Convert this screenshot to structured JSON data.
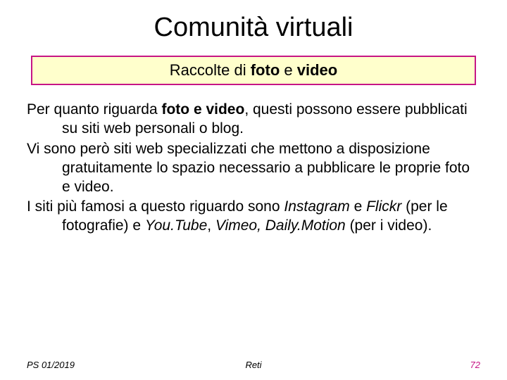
{
  "title": "Comunità virtuali",
  "subtitle_pre": "Raccolte di ",
  "subtitle_bold": "foto",
  "subtitle_mid": " e ",
  "subtitle_bold2": "video",
  "p1_a": "Per quanto riguarda ",
  "p1_b": "foto e video",
  "p1_c": ", questi possono essere pubblicati su siti web personali o blog.",
  "p2": "Vi sono però siti web specializzati che mettono a disposizione gratuitamente lo spazio necessario a pubblicare le proprie foto e video.",
  "p3_a": "I siti più famosi a questo riguardo sono ",
  "p3_b": "Instagram",
  "p3_c": " e ",
  "p3_d": "Flickr",
  "p3_e": " (per le fotografie) e ",
  "p3_f": "You.Tube",
  "p3_g": ", ",
  "p3_h": "Vimeo, Daily.Motion",
  "p3_i": " (per i video).",
  "footer_left": "PS 01/2019",
  "footer_center": "Reti",
  "footer_right": "72"
}
